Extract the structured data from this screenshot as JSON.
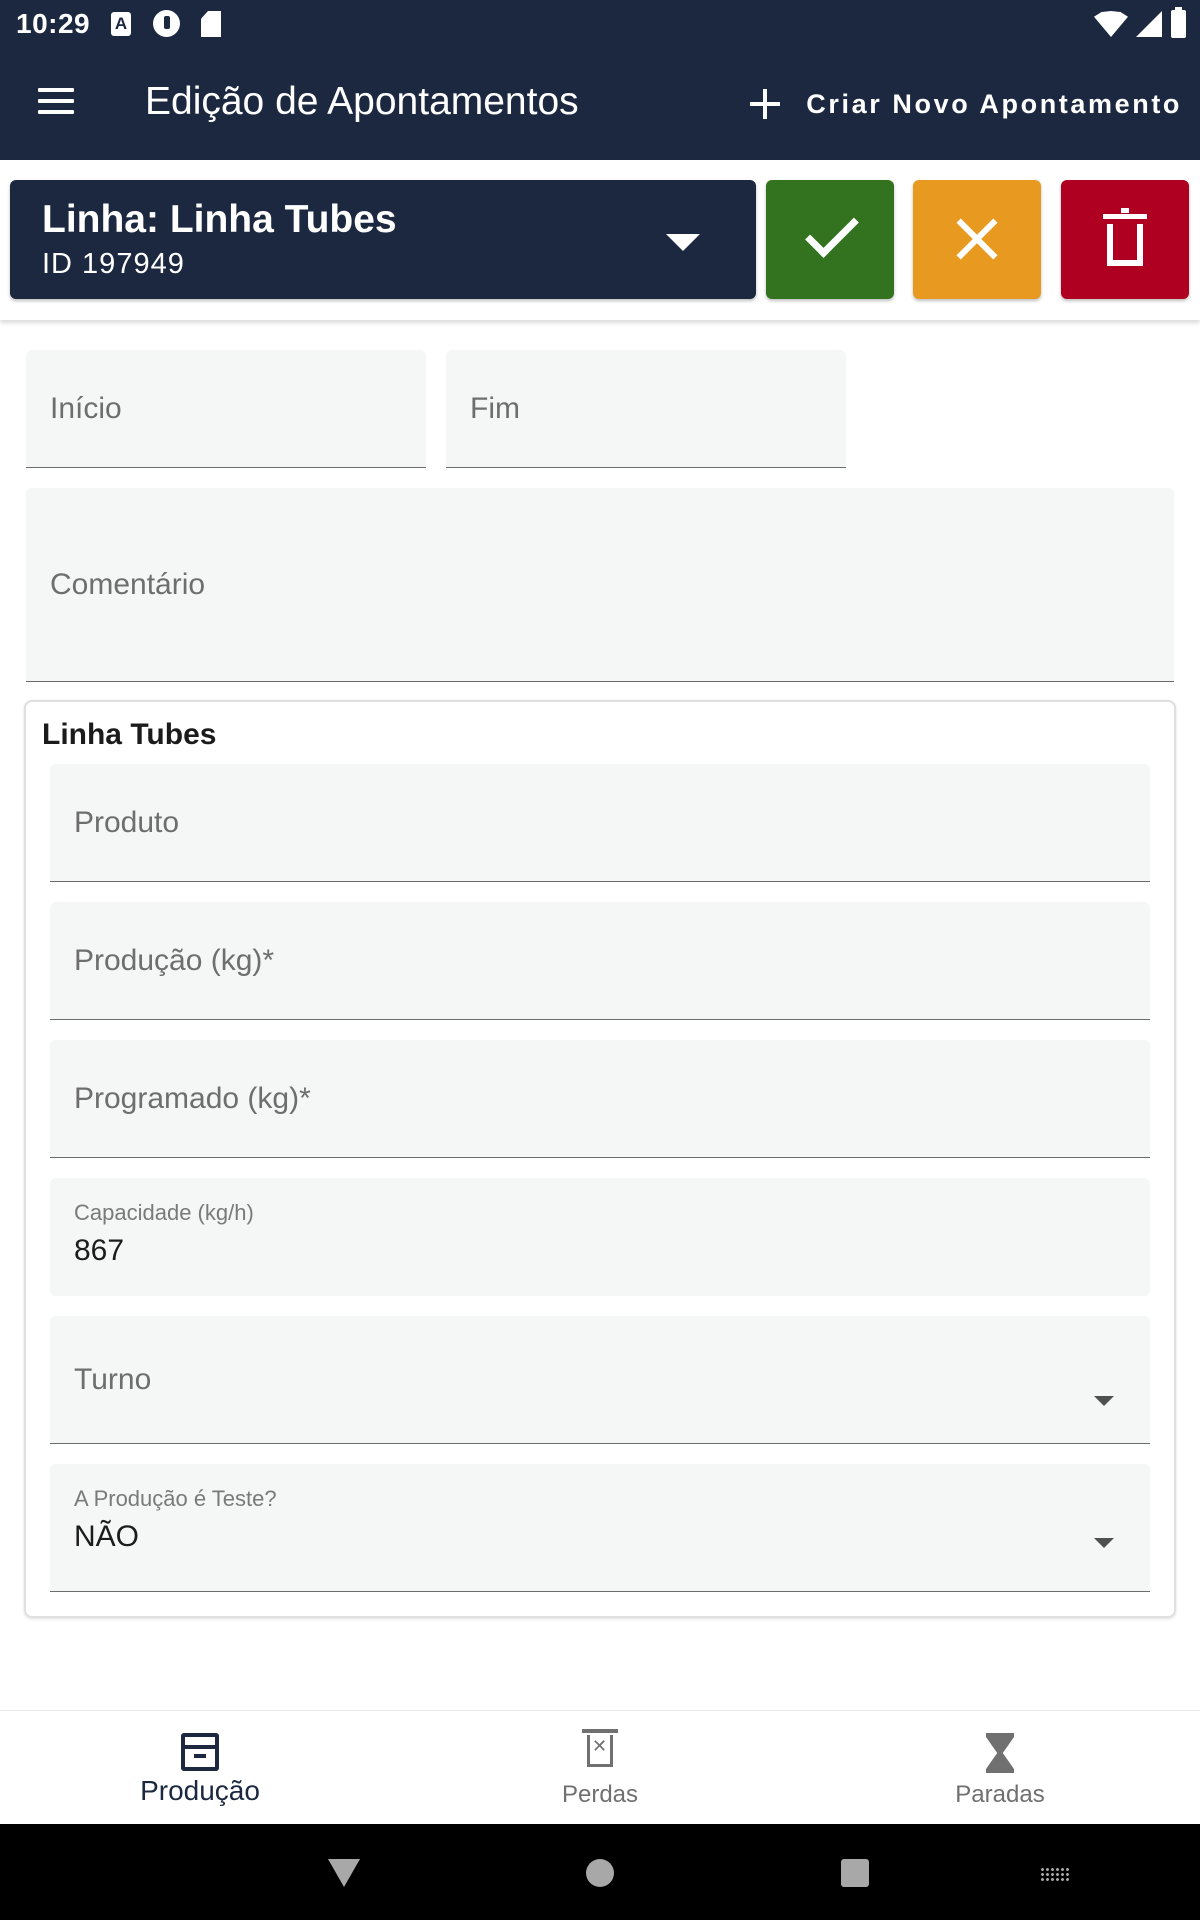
{
  "status_bar": {
    "time": "10:29",
    "left_icons": [
      "a-notification-icon",
      "p-notification-icon",
      "sd-card-icon"
    ],
    "right_icons": [
      "wifi-icon",
      "signal-icon",
      "battery-icon"
    ]
  },
  "app_bar": {
    "menu_icon": "menu-icon",
    "title": "Edição de Apontamentos",
    "create_button_label": "Criar Novo Apontamento",
    "create_icon": "plus-icon",
    "background": "#1b2840"
  },
  "toolbar": {
    "line_title": "Linha: Linha Tubes",
    "line_id": "ID 197949",
    "confirm_icon": "check-icon",
    "cancel_icon": "close-icon",
    "delete_icon": "trash-icon",
    "colors": {
      "confirm": "#33731f",
      "cancel": "#e79a1f",
      "delete": "#b00022"
    }
  },
  "form": {
    "inicio_label": "Início",
    "fim_label": "Fim",
    "comentario_label": "Comentário"
  },
  "section": {
    "title": "Linha Tubes",
    "produto_label": "Produto",
    "producao_label": "Produção (kg)*",
    "programado_label": "Programado (kg)*",
    "capacidade_label": "Capacidade (kg/h)",
    "capacidade_value": "867",
    "turno_label": "Turno",
    "teste_label": "A Produção é Teste?",
    "teste_value": "NÃO"
  },
  "bottom_nav": {
    "items": [
      {
        "label": "Produção",
        "icon": "archive-icon",
        "active": true
      },
      {
        "label": "Perdas",
        "icon": "trash-icon",
        "active": false
      },
      {
        "label": "Paradas",
        "icon": "hourglass-icon",
        "active": false
      }
    ]
  },
  "system_nav": [
    "back-icon",
    "home-icon",
    "recents-icon",
    "keyboard-icon"
  ]
}
